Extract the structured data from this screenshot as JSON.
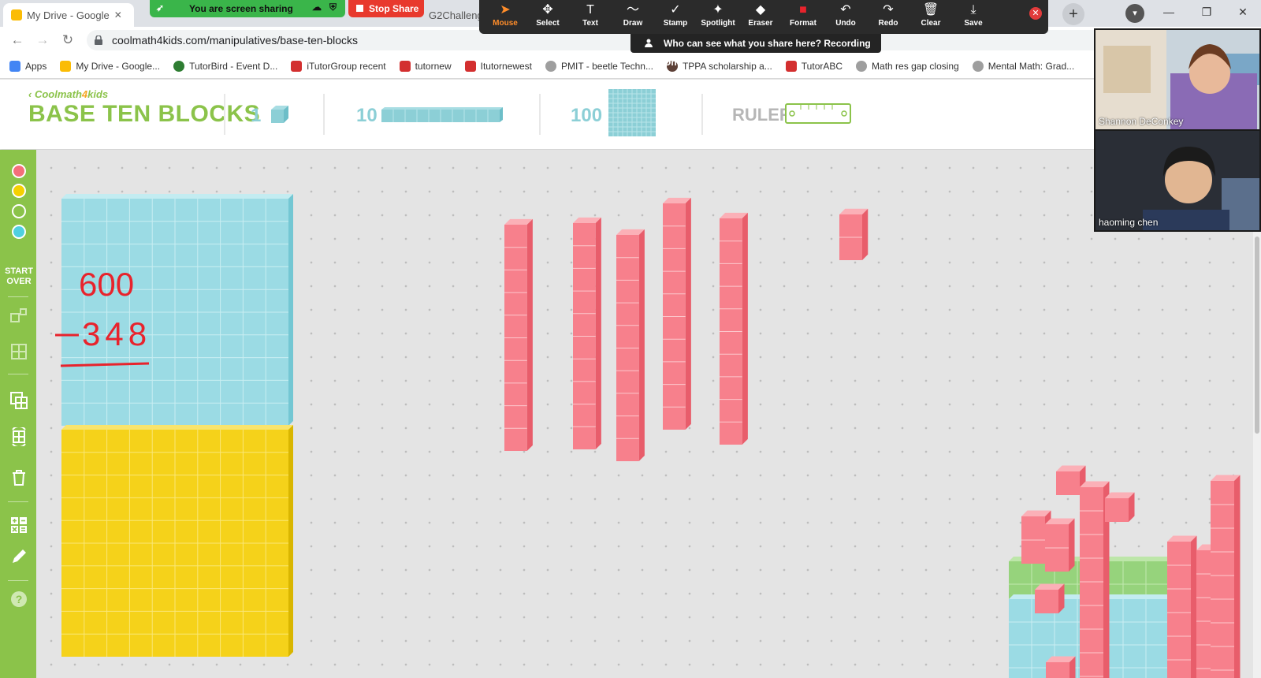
{
  "browser": {
    "tabs": [
      {
        "title": "My Drive - Google",
        "active": false
      },
      {
        "title": "G2Challeng",
        "active": false
      }
    ],
    "url": "coolmath4kids.com/manipulatives/base-ten-blocks",
    "bookmarks": [
      {
        "label": "Apps",
        "color": "#4285f4"
      },
      {
        "label": "My Drive - Google...",
        "color": "#fbbc05"
      },
      {
        "label": "TutorBird - Event D...",
        "color": "#2e7d32"
      },
      {
        "label": "iTutorGroup recent",
        "color": "#d32f2f"
      },
      {
        "label": "tutornew",
        "color": "#d32f2f"
      },
      {
        "label": "Itutornewest",
        "color": "#d32f2f"
      },
      {
        "label": "PMIT - beetle Techn...",
        "color": "#9e9e9e"
      },
      {
        "label": "TPPA scholarship a...",
        "color": "#5d4037"
      },
      {
        "label": "TutorABC",
        "color": "#d32f2f"
      },
      {
        "label": "Math res gap closing",
        "color": "#9e9e9e"
      },
      {
        "label": "Mental Math: Grad...",
        "color": "#9e9e9e"
      }
    ]
  },
  "zoom": {
    "sharing_label": "You are screen sharing",
    "stop_label": "Stop Share",
    "banner": "Who can see what you share here? Recording On",
    "tools": [
      {
        "label": "Mouse",
        "icon": "mouse-pointer-icon",
        "active": true
      },
      {
        "label": "Select",
        "icon": "move-arrows-icon",
        "active": false
      },
      {
        "label": "Text",
        "icon": "text-t-icon",
        "active": false
      },
      {
        "label": "Draw",
        "icon": "squiggle-draw-icon",
        "active": false
      },
      {
        "label": "Stamp",
        "icon": "checkmark-stamp-icon",
        "active": false
      },
      {
        "label": "Spotlight",
        "icon": "magic-wand-icon",
        "active": false
      },
      {
        "label": "Eraser",
        "icon": "eraser-icon",
        "active": false
      },
      {
        "label": "Format",
        "icon": "red-square-icon",
        "active": false
      },
      {
        "label": "Undo",
        "icon": "undo-icon",
        "active": false
      },
      {
        "label": "Redo",
        "icon": "redo-icon",
        "active": false
      },
      {
        "label": "Clear",
        "icon": "trash-icon",
        "active": false
      },
      {
        "label": "Save",
        "icon": "save-download-icon",
        "active": false
      }
    ],
    "participants": [
      {
        "name": "Shannon DeConkey"
      },
      {
        "name": "haoming   chen"
      }
    ]
  },
  "app": {
    "brand": "Coolmath",
    "brand_num": "4",
    "brand_suffix": "kids",
    "title": "BASE TEN BLOCKS",
    "block_labels": {
      "one": "1",
      "ten": "10",
      "hundred": "100",
      "ruler": "RULER"
    },
    "start_over": "START OVER",
    "palette": [
      "#f46f7a",
      "#f5d000",
      "#8bc34a",
      "#4fd0e0"
    ],
    "accent": "#8bc34a",
    "handwriting": {
      "top": "600",
      "bottom": "348"
    }
  }
}
